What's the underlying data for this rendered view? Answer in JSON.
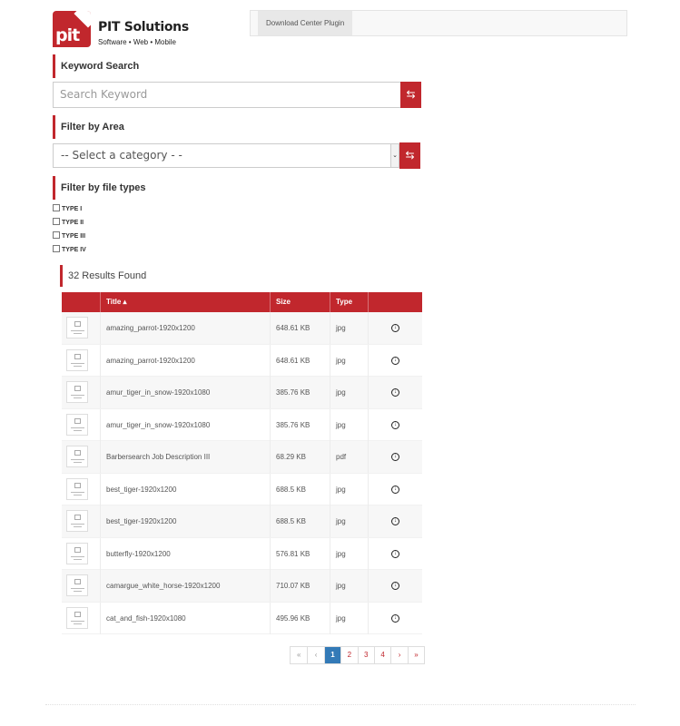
{
  "logo": {
    "mark_text": "pit",
    "name": "PIT Solutions",
    "tagline": "Software • Web • Mobile"
  },
  "topbar": {
    "tab": "Download Center Plugin"
  },
  "keyword": {
    "title": "Keyword Search",
    "placeholder": "Search Keyword",
    "button_icon": "⇆"
  },
  "area": {
    "title": "Filter by Area",
    "selected": "-- Select a category - -",
    "arrow": "⌄",
    "button_icon": "⇆"
  },
  "filetypes": {
    "title": "Filter by file types",
    "items": [
      "TYPE I",
      "TYPE II",
      "TYPE III",
      "TYPE IV"
    ]
  },
  "results": {
    "summary": "32 Results Found",
    "headers": {
      "title": "Title ▴",
      "size": "Size",
      "type": "Type"
    },
    "rows": [
      {
        "title": "amazing_parrot-1920x1200",
        "size": "648.61 KB",
        "type": "jpg"
      },
      {
        "title": "amazing_parrot-1920x1200",
        "size": "648.61 KB",
        "type": "jpg"
      },
      {
        "title": "amur_tiger_in_snow-1920x1080",
        "size": "385.76 KB",
        "type": "jpg"
      },
      {
        "title": "amur_tiger_in_snow-1920x1080",
        "size": "385.76 KB",
        "type": "jpg"
      },
      {
        "title": "Barbersearch Job Description III",
        "size": "68.29 KB",
        "type": "pdf"
      },
      {
        "title": "best_tiger-1920x1200",
        "size": "688.5 KB",
        "type": "jpg"
      },
      {
        "title": "best_tiger-1920x1200",
        "size": "688.5 KB",
        "type": "jpg"
      },
      {
        "title": "butterfly-1920x1200",
        "size": "576.81 KB",
        "type": "jpg"
      },
      {
        "title": "camargue_white_horse-1920x1200",
        "size": "710.07 KB",
        "type": "jpg"
      },
      {
        "title": "cat_and_fish-1920x1080",
        "size": "495.96 KB",
        "type": "jpg"
      }
    ],
    "download_icon": "↓"
  },
  "pagination": {
    "items": [
      "«",
      "‹",
      "1",
      "2",
      "3",
      "4",
      "›",
      "»"
    ],
    "current": "1"
  },
  "colors": {
    "accent": "#c1272d",
    "active_page": "#337ab7"
  }
}
